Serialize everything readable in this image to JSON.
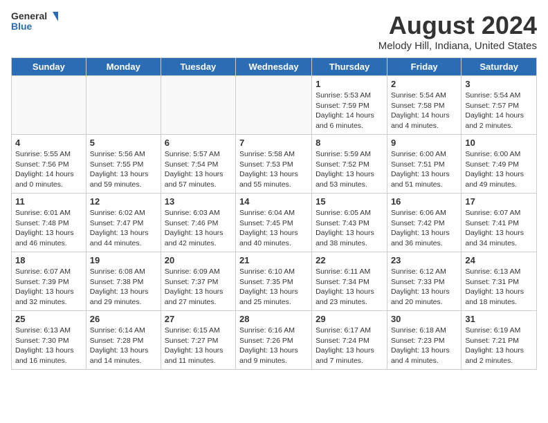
{
  "logo": {
    "general": "General",
    "blue": "Blue"
  },
  "title": "August 2024",
  "subtitle": "Melody Hill, Indiana, United States",
  "weekdays": [
    "Sunday",
    "Monday",
    "Tuesday",
    "Wednesday",
    "Thursday",
    "Friday",
    "Saturday"
  ],
  "weeks": [
    [
      {
        "day": "",
        "sunrise": "",
        "sunset": "",
        "daylight": "",
        "empty": true
      },
      {
        "day": "",
        "sunrise": "",
        "sunset": "",
        "daylight": "",
        "empty": true
      },
      {
        "day": "",
        "sunrise": "",
        "sunset": "",
        "daylight": "",
        "empty": true
      },
      {
        "day": "",
        "sunrise": "",
        "sunset": "",
        "daylight": "",
        "empty": true
      },
      {
        "day": "1",
        "sunrise": "5:53 AM",
        "sunset": "7:59 PM",
        "daylight": "14 hours and 6 minutes."
      },
      {
        "day": "2",
        "sunrise": "5:54 AM",
        "sunset": "7:58 PM",
        "daylight": "14 hours and 4 minutes."
      },
      {
        "day": "3",
        "sunrise": "5:54 AM",
        "sunset": "7:57 PM",
        "daylight": "14 hours and 2 minutes."
      }
    ],
    [
      {
        "day": "4",
        "sunrise": "5:55 AM",
        "sunset": "7:56 PM",
        "daylight": "14 hours and 0 minutes."
      },
      {
        "day": "5",
        "sunrise": "5:56 AM",
        "sunset": "7:55 PM",
        "daylight": "13 hours and 59 minutes."
      },
      {
        "day": "6",
        "sunrise": "5:57 AM",
        "sunset": "7:54 PM",
        "daylight": "13 hours and 57 minutes."
      },
      {
        "day": "7",
        "sunrise": "5:58 AM",
        "sunset": "7:53 PM",
        "daylight": "13 hours and 55 minutes."
      },
      {
        "day": "8",
        "sunrise": "5:59 AM",
        "sunset": "7:52 PM",
        "daylight": "13 hours and 53 minutes."
      },
      {
        "day": "9",
        "sunrise": "6:00 AM",
        "sunset": "7:51 PM",
        "daylight": "13 hours and 51 minutes."
      },
      {
        "day": "10",
        "sunrise": "6:00 AM",
        "sunset": "7:49 PM",
        "daylight": "13 hours and 49 minutes."
      }
    ],
    [
      {
        "day": "11",
        "sunrise": "6:01 AM",
        "sunset": "7:48 PM",
        "daylight": "13 hours and 46 minutes."
      },
      {
        "day": "12",
        "sunrise": "6:02 AM",
        "sunset": "7:47 PM",
        "daylight": "13 hours and 44 minutes."
      },
      {
        "day": "13",
        "sunrise": "6:03 AM",
        "sunset": "7:46 PM",
        "daylight": "13 hours and 42 minutes."
      },
      {
        "day": "14",
        "sunrise": "6:04 AM",
        "sunset": "7:45 PM",
        "daylight": "13 hours and 40 minutes."
      },
      {
        "day": "15",
        "sunrise": "6:05 AM",
        "sunset": "7:43 PM",
        "daylight": "13 hours and 38 minutes."
      },
      {
        "day": "16",
        "sunrise": "6:06 AM",
        "sunset": "7:42 PM",
        "daylight": "13 hours and 36 minutes."
      },
      {
        "day": "17",
        "sunrise": "6:07 AM",
        "sunset": "7:41 PM",
        "daylight": "13 hours and 34 minutes."
      }
    ],
    [
      {
        "day": "18",
        "sunrise": "6:07 AM",
        "sunset": "7:39 PM",
        "daylight": "13 hours and 32 minutes."
      },
      {
        "day": "19",
        "sunrise": "6:08 AM",
        "sunset": "7:38 PM",
        "daylight": "13 hours and 29 minutes."
      },
      {
        "day": "20",
        "sunrise": "6:09 AM",
        "sunset": "7:37 PM",
        "daylight": "13 hours and 27 minutes."
      },
      {
        "day": "21",
        "sunrise": "6:10 AM",
        "sunset": "7:35 PM",
        "daylight": "13 hours and 25 minutes."
      },
      {
        "day": "22",
        "sunrise": "6:11 AM",
        "sunset": "7:34 PM",
        "daylight": "13 hours and 23 minutes."
      },
      {
        "day": "23",
        "sunrise": "6:12 AM",
        "sunset": "7:33 PM",
        "daylight": "13 hours and 20 minutes."
      },
      {
        "day": "24",
        "sunrise": "6:13 AM",
        "sunset": "7:31 PM",
        "daylight": "13 hours and 18 minutes."
      }
    ],
    [
      {
        "day": "25",
        "sunrise": "6:13 AM",
        "sunset": "7:30 PM",
        "daylight": "13 hours and 16 minutes."
      },
      {
        "day": "26",
        "sunrise": "6:14 AM",
        "sunset": "7:28 PM",
        "daylight": "13 hours and 14 minutes."
      },
      {
        "day": "27",
        "sunrise": "6:15 AM",
        "sunset": "7:27 PM",
        "daylight": "13 hours and 11 minutes."
      },
      {
        "day": "28",
        "sunrise": "6:16 AM",
        "sunset": "7:26 PM",
        "daylight": "13 hours and 9 minutes."
      },
      {
        "day": "29",
        "sunrise": "6:17 AM",
        "sunset": "7:24 PM",
        "daylight": "13 hours and 7 minutes."
      },
      {
        "day": "30",
        "sunrise": "6:18 AM",
        "sunset": "7:23 PM",
        "daylight": "13 hours and 4 minutes."
      },
      {
        "day": "31",
        "sunrise": "6:19 AM",
        "sunset": "7:21 PM",
        "daylight": "13 hours and 2 minutes."
      }
    ]
  ]
}
